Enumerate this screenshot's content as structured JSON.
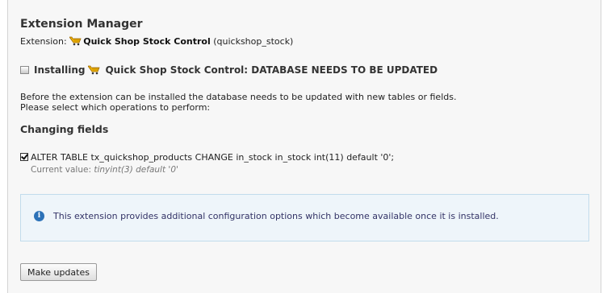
{
  "manager": {
    "title": "Extension Manager",
    "extension_prefix": "Extension: ",
    "extension_name": "Quick Shop Stock Control",
    "extension_key": " (quickshop_stock)"
  },
  "install": {
    "prefix": "Installing ",
    "name": "Quick Shop Stock Control: DATABASE NEEDS TO BE UPDATED"
  },
  "description": {
    "line1": "Before the extension can be installed the database needs to be updated with new tables or fields.",
    "line2": "Please select which operations to perform:"
  },
  "changes": {
    "heading": "Changing fields",
    "items": [
      {
        "statement": "ALTER TABLE tx_quickshop_products CHANGE in_stock in_stock int(11) default '0';",
        "checked": true,
        "current_label": "Current value: ",
        "current_value": "tinyint(3) default '0'"
      }
    ]
  },
  "info": {
    "text": "This extension provides additional configuration options which become available once it is installed."
  },
  "actions": {
    "make_updates": "Make updates"
  },
  "icons": {
    "extension": "shopping-cart-icon",
    "install": "install-icon",
    "info": "info-icon"
  },
  "colors": {
    "accent": "#2c72b8",
    "info_bg": "#eef5fa"
  }
}
